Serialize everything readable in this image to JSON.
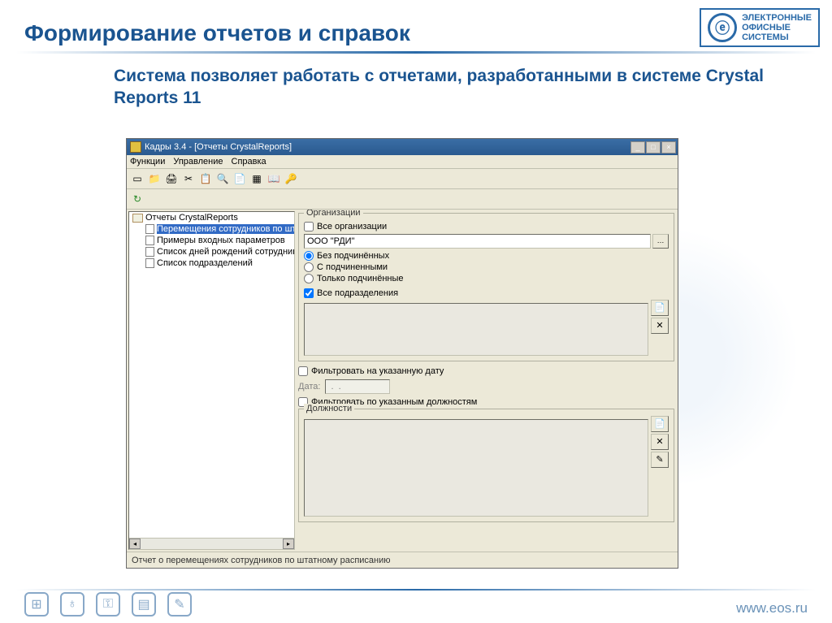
{
  "slide": {
    "title": "Формирование отчетов и справок",
    "subtitle": "Система позволяет работать с отчетами, разработанными  в системе Crystal Reports 11",
    "footer_url": "www.eos.ru",
    "logo_lines": [
      "ЭЛЕКТРОННЫЕ",
      "ОФИСНЫЕ",
      "СИСТЕМЫ"
    ]
  },
  "app": {
    "title": "Кадры 3.4 - [Отчеты CrystalReports]",
    "menus": [
      "Функции",
      "Управление",
      "Справка"
    ],
    "tree": {
      "root": "Отчеты CrystalReports",
      "items": [
        "Перемещения сотрудников по штатному",
        "Примеры входных параметров",
        "Список дней рождений сотрудников с вы",
        "Список подразделений"
      ]
    },
    "form": {
      "org_legend": "Организации",
      "all_orgs": "Все организации",
      "org_value": "ООО \"РДИ\"",
      "radio1": "Без подчинённых",
      "radio2": "С подчиненными",
      "radio3": "Только подчинённые",
      "all_depts": "Все подразделения",
      "filter_date": "Фильтровать на указанную дату",
      "date_label": "Дата:",
      "date_value": " .  .",
      "filter_positions": "Фильтровать по указанным должностям",
      "positions_legend": "Должности"
    },
    "statusbar": "Отчет о перемещениях сотрудников по штатному расписанию"
  }
}
